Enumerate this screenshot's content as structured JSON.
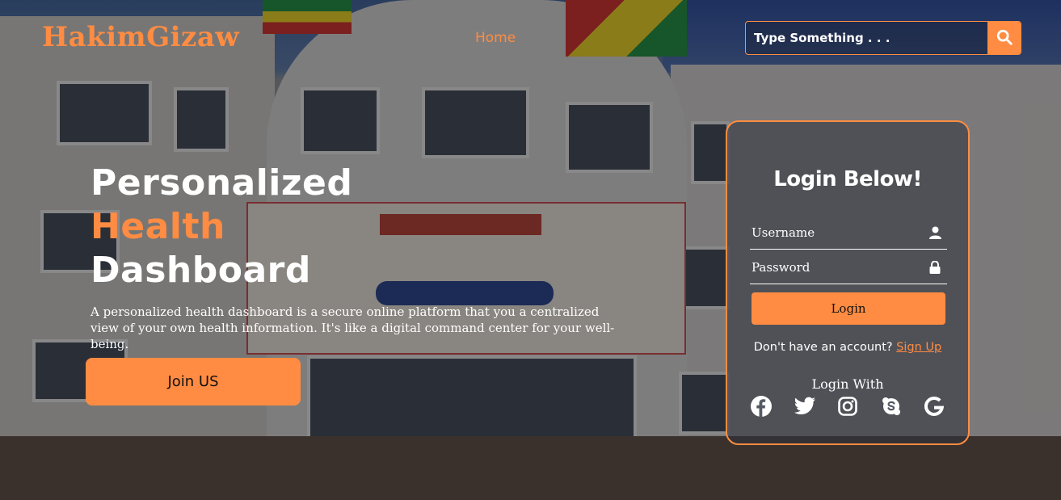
{
  "header": {
    "logo": "HakimGizaw",
    "nav": [
      {
        "label": "Home"
      }
    ],
    "search": {
      "placeholder": "Type Something . . ."
    }
  },
  "hero": {
    "title_line1": "Personalized",
    "title_line2": "Health",
    "title_line3": "Dashboard",
    "description": "A personalized health dashboard is a secure online platform that you a centralized view of your own health information. It's like a digital command center for your well-being.",
    "cta_label": "Join US"
  },
  "login": {
    "title": "Login Below!",
    "username_placeholder": "Username",
    "password_placeholder": "Password",
    "submit_label": "Login",
    "no_account_text": "Don't have an account?",
    "signup_link": "Sign Up",
    "login_with": "Login With",
    "socials": [
      "facebook-icon",
      "twitter-icon",
      "instagram-icon",
      "skype-icon",
      "google-icon"
    ]
  },
  "colors": {
    "accent": "#ff8c42",
    "text": "#ffffff"
  }
}
